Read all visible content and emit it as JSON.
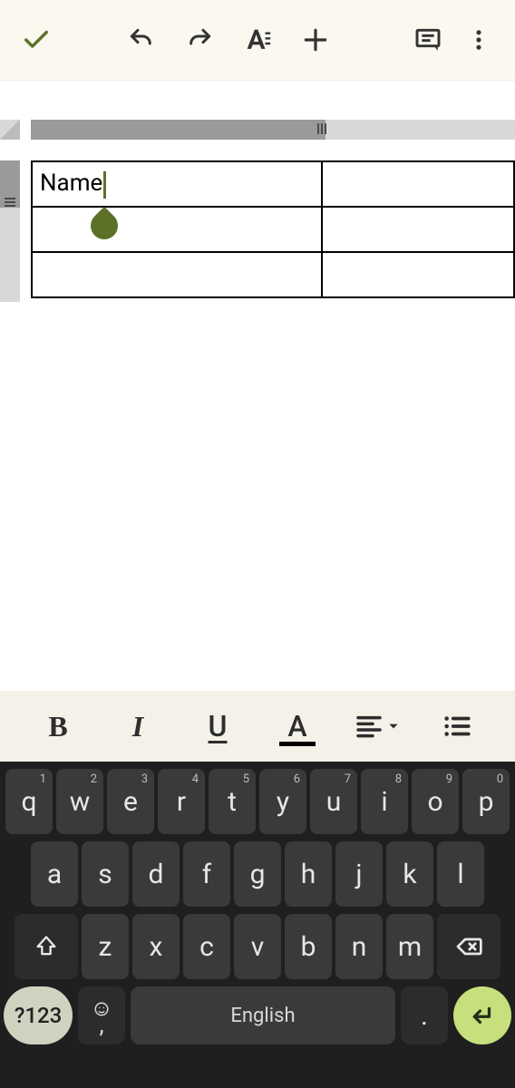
{
  "toolbar": {
    "confirm": "check-icon",
    "undo": "undo-icon",
    "redo": "redo-icon",
    "text_format": "text-format-icon",
    "insert": "plus-icon",
    "comment": "comment-icon",
    "more": "more-vert-icon"
  },
  "table": {
    "rows": [
      {
        "a": "Name",
        "b": ""
      },
      {
        "a": "",
        "b": ""
      },
      {
        "a": "",
        "b": ""
      }
    ],
    "active_cell": "A1"
  },
  "format_bar": {
    "bold": "B",
    "italic": "I",
    "underline": "U",
    "textcolor": "A",
    "align": "align-icon",
    "list": "list-icon"
  },
  "keyboard": {
    "row1": [
      {
        "k": "q",
        "s": "1"
      },
      {
        "k": "w",
        "s": "2"
      },
      {
        "k": "e",
        "s": "3"
      },
      {
        "k": "r",
        "s": "4"
      },
      {
        "k": "t",
        "s": "5"
      },
      {
        "k": "y",
        "s": "6"
      },
      {
        "k": "u",
        "s": "7"
      },
      {
        "k": "i",
        "s": "8"
      },
      {
        "k": "o",
        "s": "9"
      },
      {
        "k": "p",
        "s": "0"
      }
    ],
    "row2": [
      {
        "k": "a"
      },
      {
        "k": "s"
      },
      {
        "k": "d"
      },
      {
        "k": "f"
      },
      {
        "k": "g"
      },
      {
        "k": "h"
      },
      {
        "k": "j"
      },
      {
        "k": "k"
      },
      {
        "k": "l"
      }
    ],
    "row3": [
      {
        "k": "z"
      },
      {
        "k": "x"
      },
      {
        "k": "c"
      },
      {
        "k": "v"
      },
      {
        "k": "b"
      },
      {
        "k": "n"
      },
      {
        "k": "m"
      }
    ],
    "symbols_label": "?123",
    "space_label": "English",
    "comma_label": ",",
    "dot_label": "."
  }
}
